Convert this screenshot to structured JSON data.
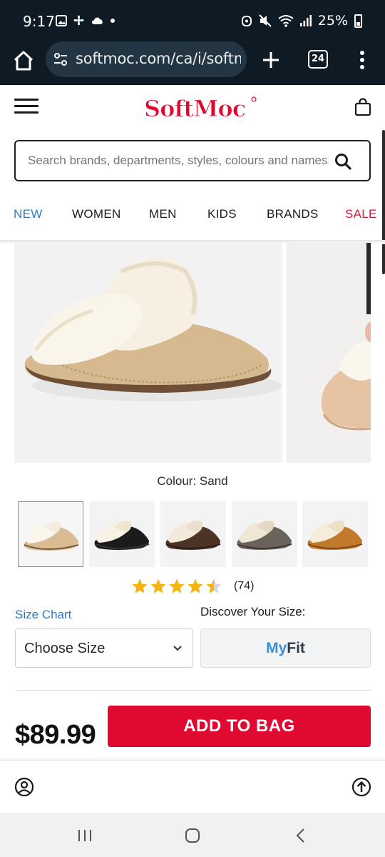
{
  "status_bar": {
    "time": "9:17",
    "battery": "25%"
  },
  "browser": {
    "url": "softmoc.com/ca/i/softmoc",
    "tab_count": "24"
  },
  "header": {
    "logo_text": "SoftMoc",
    "brand_color": "#e0092f"
  },
  "search": {
    "placeholder": "Search brands, departments, styles, colours and names"
  },
  "nav": {
    "items": [
      {
        "label": "NEW",
        "color": "#2b7bbf"
      },
      {
        "label": "WOMEN",
        "color": "#1c1c1c"
      },
      {
        "label": "MEN",
        "color": "#1c1c1c"
      },
      {
        "label": "KIDS",
        "color": "#1c1c1c"
      },
      {
        "label": "BRANDS",
        "color": "#1c1c1c"
      },
      {
        "label": "SALE",
        "color": "#d9163c"
      }
    ]
  },
  "product": {
    "colour_label": "Colour: Sand",
    "swatches": [
      {
        "name": "Sand",
        "selected": true
      },
      {
        "name": "Black",
        "selected": false
      },
      {
        "name": "Brown",
        "selected": false
      },
      {
        "name": "Grey",
        "selected": false
      },
      {
        "name": "Chestnut",
        "selected": false
      }
    ],
    "rating": {
      "value": 4.5,
      "max": 5,
      "count": "(74)"
    },
    "size_chart_label": "Size Chart",
    "discover_label": "Discover Your Size:",
    "size_select_value": "Choose Size",
    "myfit": {
      "my": "My",
      "fit": "Fit"
    },
    "price": "$89.99",
    "add_to_bag_label": "ADD TO BAG"
  },
  "icons": {
    "home": "home-icon",
    "tune": "site-settings-icon",
    "new_tab": "plus-icon",
    "menu": "more-vertical-icon",
    "hamburger": "hamburger-menu-icon",
    "bag": "shopping-bag-icon",
    "search": "search-icon",
    "account": "account-icon",
    "back_to_top": "arrow-up-circle-icon"
  }
}
